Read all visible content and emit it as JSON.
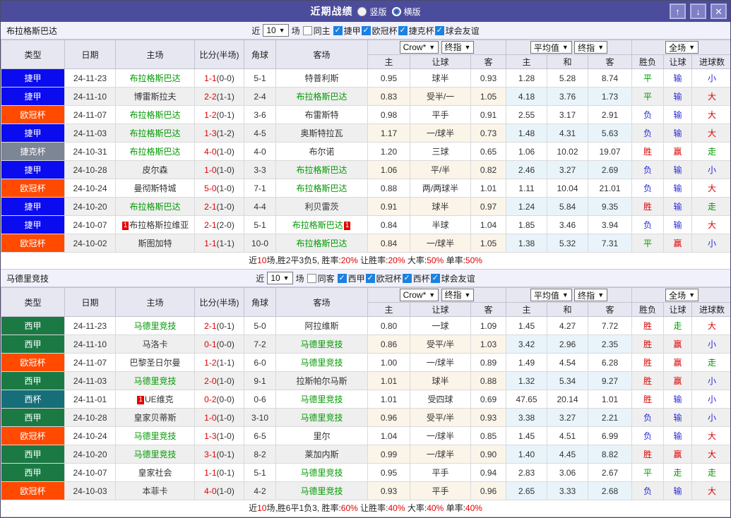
{
  "window": {
    "title": "近期战绩",
    "radios": [
      {
        "label": "竖版",
        "selected": true
      },
      {
        "label": "横版",
        "selected": false
      }
    ],
    "buttons": {
      "up": "↑",
      "down": "↓",
      "close": "✕"
    },
    "title_bar_color": "#4c4c9d"
  },
  "table_columns": {
    "type": "类型",
    "date": "日期",
    "home": "主场",
    "score": "比分(半场)",
    "corner": "角球",
    "away": "客场",
    "odds_select": "Crow*",
    "odds_final": "终指",
    "odds_sub": [
      "主",
      "让球",
      "客"
    ],
    "avg_select": "平均值",
    "avg_final": "终指",
    "avg_sub": [
      "主",
      "和",
      "客"
    ],
    "full_select": "全场",
    "full_sub": [
      "胜负",
      "让球",
      "进球数"
    ]
  },
  "league_colors": {
    "捷甲": "#0b0bef",
    "欧冠杯": "#ff4a00",
    "捷克杯": "#7c8694",
    "西甲": "#1b7a44",
    "西杯": "#166f78"
  },
  "result_colors": {
    "r": "#dd0000",
    "g": "#009900",
    "b": "#2b2bd5"
  },
  "sections": [
    {
      "team": "布拉格斯巴达",
      "filter": {
        "near": "近",
        "count": "10",
        "games": "场",
        "same": {
          "label": "同主",
          "checked": false
        },
        "leagues": [
          {
            "label": "捷甲",
            "checked": true
          },
          {
            "label": "欧冠杯",
            "checked": true
          },
          {
            "label": "捷克杯",
            "checked": true
          },
          {
            "label": "球会友谊",
            "checked": true
          }
        ]
      },
      "rows": [
        {
          "league": "捷甲",
          "date": "24-11-23",
          "home": {
            "name": "布拉格斯巴达",
            "hl": true
          },
          "score": "1-1",
          "half": "(0-0)",
          "corner": "5-1",
          "away": {
            "name": "特普利斯",
            "hl": false
          },
          "odds": [
            "0.95",
            "球半",
            "0.93"
          ],
          "avg": [
            "1.28",
            "5.28",
            "8.74"
          ],
          "res": [
            "平",
            "g"
          ],
          "let": [
            "输",
            "b"
          ],
          "goal": [
            "小",
            "b"
          ]
        },
        {
          "league": "捷甲",
          "date": "24-11-10",
          "home": {
            "name": "博雷斯拉夫",
            "hl": false
          },
          "score": "2-2",
          "half": "(1-1)",
          "corner": "2-4",
          "away": {
            "name": "布拉格斯巴达",
            "hl": true
          },
          "odds": [
            "0.83",
            "受半/一",
            "1.05"
          ],
          "avg": [
            "4.18",
            "3.76",
            "1.73"
          ],
          "res": [
            "平",
            "g"
          ],
          "let": [
            "输",
            "b"
          ],
          "goal": [
            "大",
            "r"
          ]
        },
        {
          "league": "欧冠杯",
          "date": "24-11-07",
          "home": {
            "name": "布拉格斯巴达",
            "hl": true
          },
          "score": "1-2",
          "half": "(0-1)",
          "corner": "3-6",
          "away": {
            "name": "布雷斯特",
            "hl": false
          },
          "odds": [
            "0.98",
            "平手",
            "0.91"
          ],
          "avg": [
            "2.55",
            "3.17",
            "2.91"
          ],
          "res": [
            "负",
            "b"
          ],
          "let": [
            "输",
            "b"
          ],
          "goal": [
            "大",
            "r"
          ]
        },
        {
          "league": "捷甲",
          "date": "24-11-03",
          "home": {
            "name": "布拉格斯巴达",
            "hl": true
          },
          "score": "1-3",
          "half": "(1-2)",
          "corner": "4-5",
          "away": {
            "name": "奥斯特拉瓦",
            "hl": false
          },
          "odds": [
            "1.17",
            "一/球半",
            "0.73"
          ],
          "avg": [
            "1.48",
            "4.31",
            "5.63"
          ],
          "res": [
            "负",
            "b"
          ],
          "let": [
            "输",
            "b"
          ],
          "goal": [
            "大",
            "r"
          ]
        },
        {
          "league": "捷克杯",
          "date": "24-10-31",
          "home": {
            "name": "布拉格斯巴达",
            "hl": true
          },
          "score": "4-0",
          "half": "(1-0)",
          "corner": "4-0",
          "away": {
            "name": "布尔诺",
            "hl": false
          },
          "odds": [
            "1.20",
            "三球",
            "0.65"
          ],
          "avg": [
            "1.06",
            "10.02",
            "19.07"
          ],
          "res": [
            "胜",
            "r"
          ],
          "let": [
            "赢",
            "r"
          ],
          "goal": [
            "走",
            "g"
          ]
        },
        {
          "league": "捷甲",
          "date": "24-10-28",
          "home": {
            "name": "皮尔森",
            "hl": false
          },
          "score": "1-0",
          "half": "(1-0)",
          "corner": "3-3",
          "away": {
            "name": "布拉格斯巴达",
            "hl": true
          },
          "odds": [
            "1.06",
            "平/半",
            "0.82"
          ],
          "avg": [
            "2.46",
            "3.27",
            "2.69"
          ],
          "res": [
            "负",
            "b"
          ],
          "let": [
            "输",
            "b"
          ],
          "goal": [
            "小",
            "b"
          ]
        },
        {
          "league": "欧冠杯",
          "date": "24-10-24",
          "home": {
            "name": "曼彻斯特城",
            "hl": false
          },
          "score": "5-0",
          "half": "(1-0)",
          "corner": "7-1",
          "away": {
            "name": "布拉格斯巴达",
            "hl": true
          },
          "odds": [
            "0.88",
            "两/两球半",
            "1.01"
          ],
          "avg": [
            "1.11",
            "10.04",
            "21.01"
          ],
          "res": [
            "负",
            "b"
          ],
          "let": [
            "输",
            "b"
          ],
          "goal": [
            "大",
            "r"
          ]
        },
        {
          "league": "捷甲",
          "date": "24-10-20",
          "home": {
            "name": "布拉格斯巴达",
            "hl": true
          },
          "score": "2-1",
          "half": "(1-0)",
          "corner": "4-4",
          "away": {
            "name": "利贝雷茨",
            "hl": false
          },
          "odds": [
            "0.91",
            "球半",
            "0.97"
          ],
          "avg": [
            "1.24",
            "5.84",
            "9.35"
          ],
          "res": [
            "胜",
            "r"
          ],
          "let": [
            "输",
            "b"
          ],
          "goal": [
            "走",
            "g"
          ]
        },
        {
          "league": "捷甲",
          "date": "24-10-07",
          "home": {
            "name": "布拉格斯拉维亚",
            "hl": false,
            "card_before": "1"
          },
          "score": "2-1",
          "half": "(2-0)",
          "corner": "5-1",
          "away": {
            "name": "布拉格斯巴达",
            "hl": true,
            "card_after": "1"
          },
          "odds": [
            "0.84",
            "半球",
            "1.04"
          ],
          "avg": [
            "1.85",
            "3.46",
            "3.94"
          ],
          "res": [
            "负",
            "b"
          ],
          "let": [
            "输",
            "b"
          ],
          "goal": [
            "大",
            "r"
          ]
        },
        {
          "league": "欧冠杯",
          "date": "24-10-02",
          "home": {
            "name": "斯图加特",
            "hl": false
          },
          "score": "1-1",
          "half": "(1-1)",
          "corner": "10-0",
          "away": {
            "name": "布拉格斯巴达",
            "hl": true
          },
          "odds": [
            "0.84",
            "一/球半",
            "1.05"
          ],
          "avg": [
            "1.38",
            "5.32",
            "7.31"
          ],
          "res": [
            "平",
            "g"
          ],
          "let": [
            "赢",
            "r"
          ],
          "goal": [
            "小",
            "b"
          ]
        }
      ],
      "summary": [
        [
          "近",
          "k"
        ],
        [
          "10",
          "r"
        ],
        [
          "场,胜2平3负5, 胜率:",
          "k"
        ],
        [
          "20%",
          "r"
        ],
        [
          " 让胜率:",
          "k"
        ],
        [
          "20%",
          "r"
        ],
        [
          " 大率:",
          "k"
        ],
        [
          "50%",
          "r"
        ],
        [
          " 单率:",
          "k"
        ],
        [
          "50%",
          "r"
        ]
      ]
    },
    {
      "team": "马德里竞技",
      "filter": {
        "near": "近",
        "count": "10",
        "games": "场",
        "same": {
          "label": "同客",
          "checked": false
        },
        "leagues": [
          {
            "label": "西甲",
            "checked": true
          },
          {
            "label": "欧冠杯",
            "checked": true
          },
          {
            "label": "西杯",
            "checked": true
          },
          {
            "label": "球会友谊",
            "checked": true
          }
        ]
      },
      "rows": [
        {
          "league": "西甲",
          "date": "24-11-23",
          "home": {
            "name": "马德里竞技",
            "hl": true
          },
          "score": "2-1",
          "half": "(0-1)",
          "corner": "5-0",
          "away": {
            "name": "阿拉维斯",
            "hl": false
          },
          "odds": [
            "0.80",
            "一球",
            "1.09"
          ],
          "avg": [
            "1.45",
            "4.27",
            "7.72"
          ],
          "res": [
            "胜",
            "r"
          ],
          "let": [
            "走",
            "g"
          ],
          "goal": [
            "大",
            "r"
          ]
        },
        {
          "league": "西甲",
          "date": "24-11-10",
          "home": {
            "name": "马洛卡",
            "hl": false
          },
          "score": "0-1",
          "half": "(0-0)",
          "corner": "7-2",
          "away": {
            "name": "马德里竞技",
            "hl": true
          },
          "odds": [
            "0.86",
            "受平/半",
            "1.03"
          ],
          "avg": [
            "3.42",
            "2.96",
            "2.35"
          ],
          "res": [
            "胜",
            "r"
          ],
          "let": [
            "赢",
            "r"
          ],
          "goal": [
            "小",
            "b"
          ]
        },
        {
          "league": "欧冠杯",
          "date": "24-11-07",
          "home": {
            "name": "巴黎圣日尔曼",
            "hl": false
          },
          "score": "1-2",
          "half": "(1-1)",
          "corner": "6-0",
          "away": {
            "name": "马德里竞技",
            "hl": true
          },
          "odds": [
            "1.00",
            "一/球半",
            "0.89"
          ],
          "avg": [
            "1.49",
            "4.54",
            "6.28"
          ],
          "res": [
            "胜",
            "r"
          ],
          "let": [
            "赢",
            "r"
          ],
          "goal": [
            "走",
            "g"
          ]
        },
        {
          "league": "西甲",
          "date": "24-11-03",
          "home": {
            "name": "马德里竞技",
            "hl": true
          },
          "score": "2-0",
          "half": "(1-0)",
          "corner": "9-1",
          "away": {
            "name": "拉斯帕尔马斯",
            "hl": false
          },
          "odds": [
            "1.01",
            "球半",
            "0.88"
          ],
          "avg": [
            "1.32",
            "5.34",
            "9.27"
          ],
          "res": [
            "胜",
            "r"
          ],
          "let": [
            "赢",
            "r"
          ],
          "goal": [
            "小",
            "b"
          ]
        },
        {
          "league": "西杯",
          "date": "24-11-01",
          "home": {
            "name": "UE维克",
            "hl": false,
            "card_before": "1"
          },
          "score": "0-2",
          "half": "(0-0)",
          "corner": "0-6",
          "away": {
            "name": "马德里竞技",
            "hl": true
          },
          "odds": [
            "1.01",
            "受四球",
            "0.69"
          ],
          "avg": [
            "47.65",
            "20.14",
            "1.01"
          ],
          "res": [
            "胜",
            "r"
          ],
          "let": [
            "输",
            "b"
          ],
          "goal": [
            "小",
            "b"
          ]
        },
        {
          "league": "西甲",
          "date": "24-10-28",
          "home": {
            "name": "皇家贝蒂斯",
            "hl": false
          },
          "score": "1-0",
          "half": "(1-0)",
          "corner": "3-10",
          "away": {
            "name": "马德里竞技",
            "hl": true
          },
          "odds": [
            "0.96",
            "受平/半",
            "0.93"
          ],
          "avg": [
            "3.38",
            "3.27",
            "2.21"
          ],
          "res": [
            "负",
            "b"
          ],
          "let": [
            "输",
            "b"
          ],
          "goal": [
            "小",
            "b"
          ]
        },
        {
          "league": "欧冠杯",
          "date": "24-10-24",
          "home": {
            "name": "马德里竞技",
            "hl": true
          },
          "score": "1-3",
          "half": "(1-0)",
          "corner": "6-5",
          "away": {
            "name": "里尔",
            "hl": false
          },
          "odds": [
            "1.04",
            "一/球半",
            "0.85"
          ],
          "avg": [
            "1.45",
            "4.51",
            "6.99"
          ],
          "res": [
            "负",
            "b"
          ],
          "let": [
            "输",
            "b"
          ],
          "goal": [
            "大",
            "r"
          ]
        },
        {
          "league": "西甲",
          "date": "24-10-20",
          "home": {
            "name": "马德里竞技",
            "hl": true
          },
          "score": "3-1",
          "half": "(0-1)",
          "corner": "8-2",
          "away": {
            "name": "莱加内斯",
            "hl": false
          },
          "odds": [
            "0.99",
            "一/球半",
            "0.90"
          ],
          "avg": [
            "1.40",
            "4.45",
            "8.82"
          ],
          "res": [
            "胜",
            "r"
          ],
          "let": [
            "赢",
            "r"
          ],
          "goal": [
            "大",
            "r"
          ]
        },
        {
          "league": "西甲",
          "date": "24-10-07",
          "home": {
            "name": "皇家社会",
            "hl": false
          },
          "score": "1-1",
          "half": "(0-1)",
          "corner": "5-1",
          "away": {
            "name": "马德里竞技",
            "hl": true
          },
          "odds": [
            "0.95",
            "平手",
            "0.94"
          ],
          "avg": [
            "2.83",
            "3.06",
            "2.67"
          ],
          "res": [
            "平",
            "g"
          ],
          "let": [
            "走",
            "g"
          ],
          "goal": [
            "走",
            "g"
          ]
        },
        {
          "league": "欧冠杯",
          "date": "24-10-03",
          "home": {
            "name": "本菲卡",
            "hl": false
          },
          "score": "4-0",
          "half": "(1-0)",
          "corner": "4-2",
          "away": {
            "name": "马德里竞技",
            "hl": true
          },
          "odds": [
            "0.93",
            "平手",
            "0.96"
          ],
          "avg": [
            "2.65",
            "3.33",
            "2.68"
          ],
          "res": [
            "负",
            "b"
          ],
          "let": [
            "输",
            "b"
          ],
          "goal": [
            "大",
            "r"
          ]
        }
      ],
      "summary": [
        [
          "近",
          "k"
        ],
        [
          "10",
          "r"
        ],
        [
          "场,胜6平1负3, 胜率:",
          "k"
        ],
        [
          "60%",
          "r"
        ],
        [
          " 让胜率:",
          "k"
        ],
        [
          "40%",
          "r"
        ],
        [
          " 大率:",
          "k"
        ],
        [
          "40%",
          "r"
        ],
        [
          " 单率:",
          "k"
        ],
        [
          "40%",
          "r"
        ]
      ]
    }
  ]
}
